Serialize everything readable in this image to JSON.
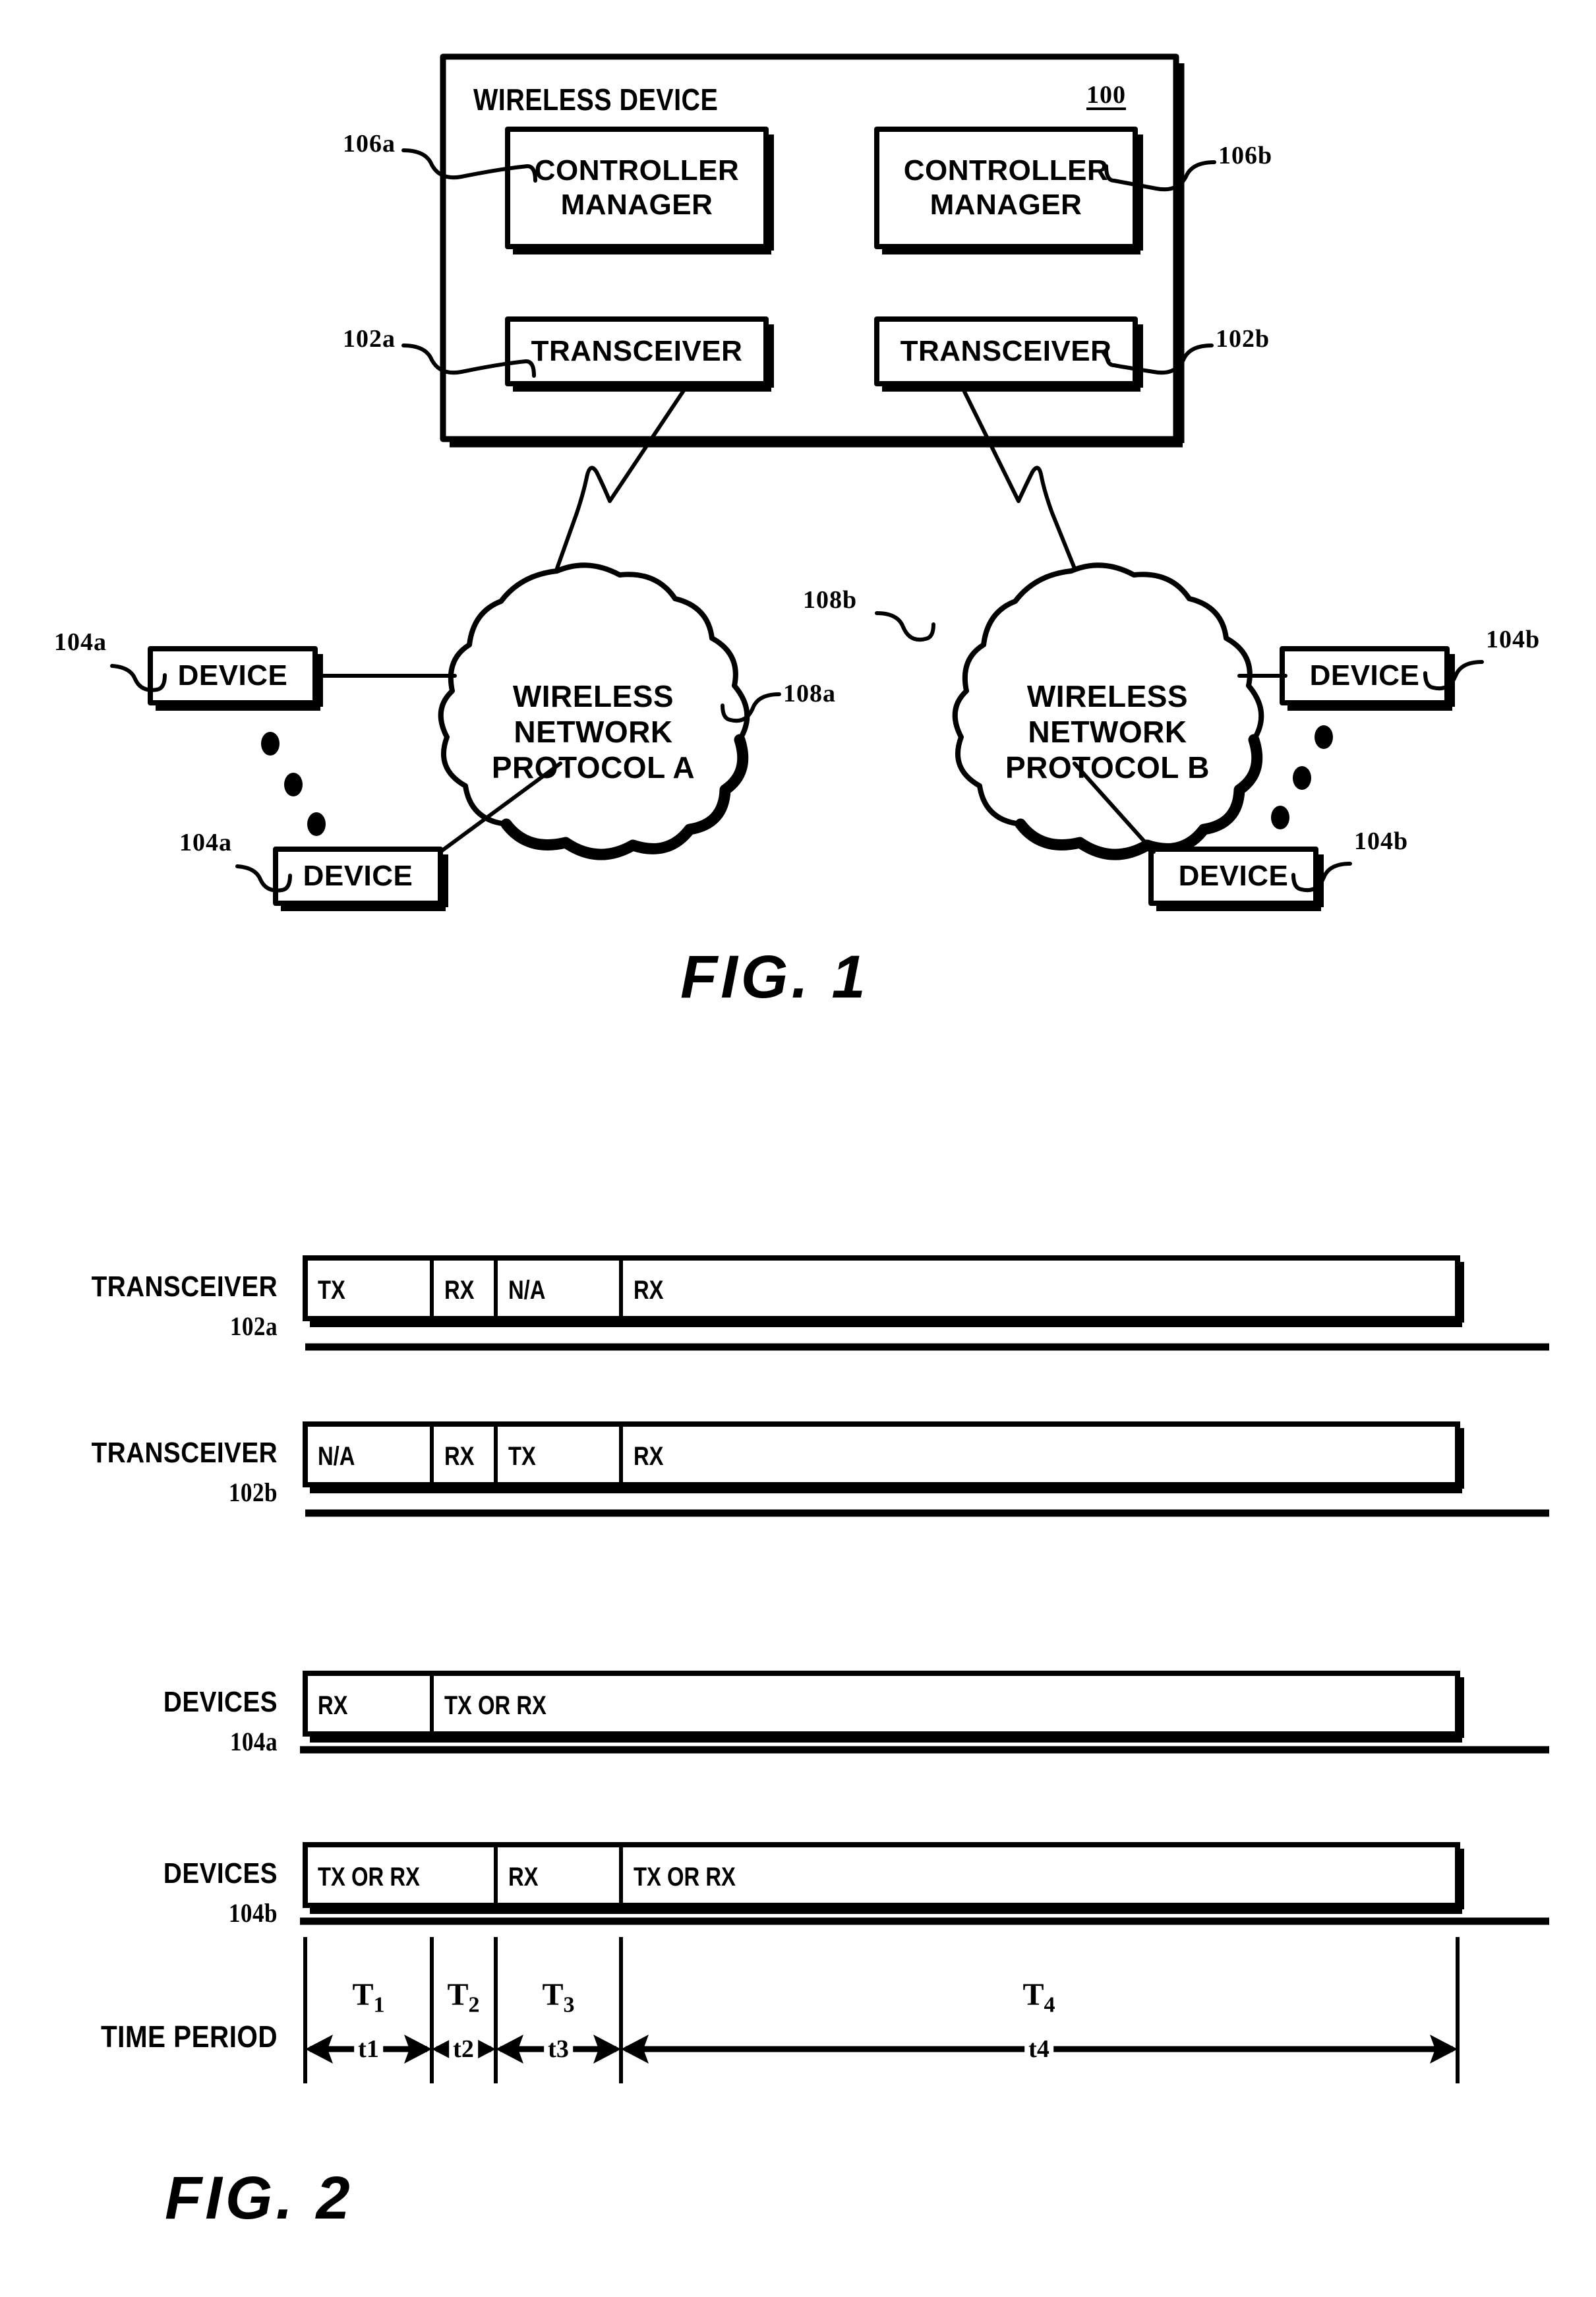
{
  "sheet": {
    "background": "#ffffff",
    "ink": "#000000"
  },
  "figures": [
    {
      "caption": "FIG. 1",
      "title_label": "WIRELESS DEVICE",
      "device_ref": "100",
      "blocks": [
        {
          "label": "CONTROLLER\nMANAGER",
          "ref": "106a"
        },
        {
          "label": "CONTROLLER\nMANAGER",
          "ref": "106b"
        },
        {
          "label": "TRANSCEIVER",
          "ref": "102a"
        },
        {
          "label": "TRANSCEIVER",
          "ref": "102b"
        }
      ],
      "clouds": [
        {
          "label": "WIRELESS\nNETWORK\nPROTOCOL A",
          "ref": "108a"
        },
        {
          "label": "WIRELESS\nNETWORK\nPROTOCOL B",
          "ref": "108b"
        }
      ],
      "devices": [
        {
          "label": "DEVICE",
          "ref": "104a"
        },
        {
          "label": "DEVICE",
          "ref": "104a"
        },
        {
          "label": "DEVICE",
          "ref": "104b"
        },
        {
          "label": "DEVICE",
          "ref": "104b"
        }
      ]
    },
    {
      "caption": "FIG. 2",
      "time_period_label": "TIME PERIOD",
      "rows": [
        {
          "name": "TRANSCEIVER",
          "ref": "102a",
          "segments": [
            {
              "label": "TX",
              "span": 1
            },
            {
              "label": "RX",
              "span": 1
            },
            {
              "label": "N/A",
              "span": 1
            },
            {
              "label": "RX",
              "span": 1
            }
          ]
        },
        {
          "name": "TRANSCEIVER",
          "ref": "102b",
          "segments": [
            {
              "label": "N/A",
              "span": 1
            },
            {
              "label": "RX",
              "span": 1
            },
            {
              "label": "TX",
              "span": 1
            },
            {
              "label": "RX",
              "span": 1
            }
          ]
        },
        {
          "name": "DEVICES",
          "ref": "104a",
          "segments": [
            {
              "label": "RX",
              "span": 1
            },
            {
              "label": "TX OR RX",
              "span": 3
            }
          ]
        },
        {
          "name": "DEVICES",
          "ref": "104b",
          "segments": [
            {
              "label": "TX OR RX",
              "span": 2
            },
            {
              "label": "RX",
              "span": 1
            },
            {
              "label": "TX OR RX",
              "span": 1
            }
          ]
        }
      ],
      "time_periods": [
        {
          "period": "T",
          "index": "1",
          "interval": "t1"
        },
        {
          "period": "T",
          "index": "2",
          "interval": "t2"
        },
        {
          "period": "T",
          "index": "3",
          "interval": "t3"
        },
        {
          "period": "T",
          "index": "4",
          "interval": "t4"
        }
      ]
    }
  ]
}
